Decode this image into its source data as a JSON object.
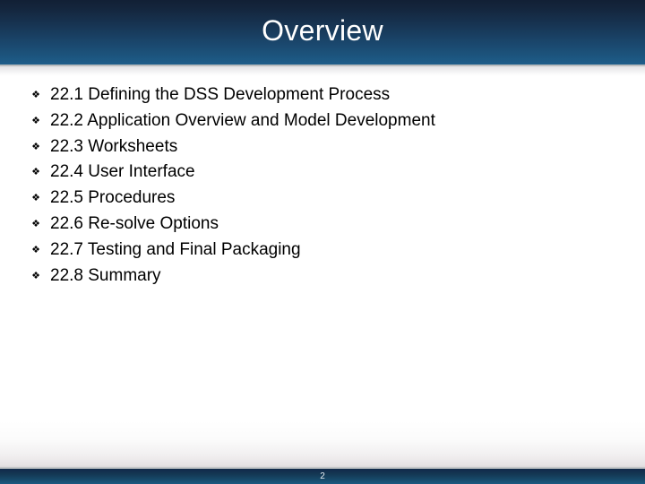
{
  "slide": {
    "title": "Overview",
    "bullet_glyph": "❖",
    "items": [
      {
        "text": "22.1 Defining the DSS Development Process"
      },
      {
        "text": "22.2 Application Overview and Model Development"
      },
      {
        "text": "22.3 Worksheets"
      },
      {
        "text": "22.4 User Interface"
      },
      {
        "text": "22.5 Procedures"
      },
      {
        "text": "22.6 Re-solve Options"
      },
      {
        "text": "22.7 Testing and Final Packaging"
      },
      {
        "text": "22.8 Summary"
      }
    ],
    "footer": {
      "page_number": "2"
    },
    "colors": {
      "header_top": "#14253c",
      "header_bottom": "#1e5e8a",
      "title_text": "#ffffff",
      "body_background": "#ffffff",
      "body_text": "#000000",
      "divider": "#b9bcbe",
      "footer_top": "#11294a",
      "footer_bottom": "#1b5a80",
      "page_number_text": "#e8eef3"
    }
  }
}
